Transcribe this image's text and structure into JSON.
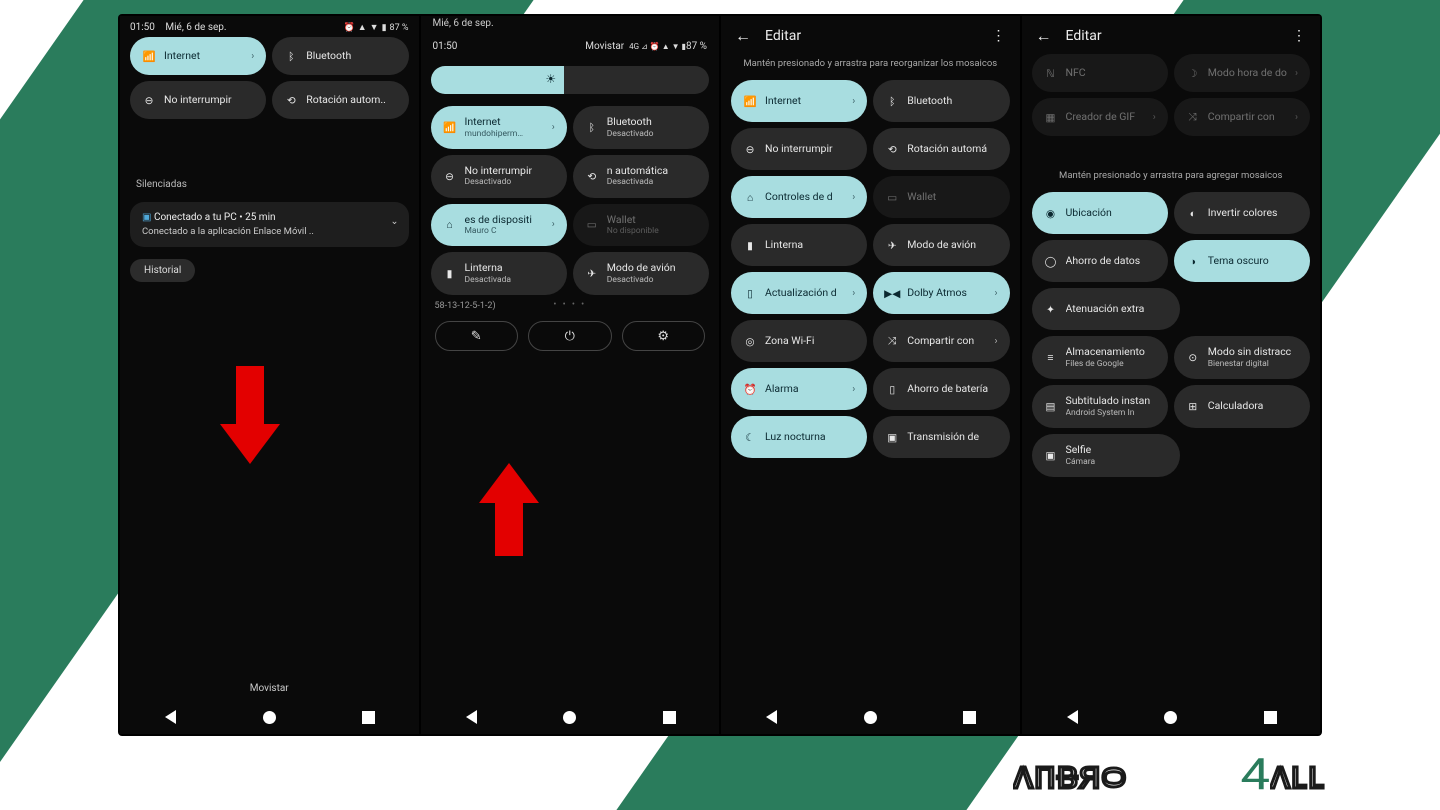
{
  "brand": {
    "name": "ANDRO",
    "accent": "4",
    "suffix": "ALL"
  },
  "colors": {
    "accent": "#a8dde0",
    "tileOff": "#2a2a2a",
    "bg": "#0a0a0a",
    "stripe": "#2a7c5c",
    "arrow": "#e30000"
  },
  "s1": {
    "status": {
      "time": "01:50",
      "date": "Mié, 6 de sep.",
      "carrier": "Movistar",
      "battery": "87 %"
    },
    "tiles": [
      {
        "label": "Internet",
        "on": true,
        "chev": true,
        "ico": "wifi"
      },
      {
        "label": "Bluetooth",
        "on": false,
        "ico": "bt"
      },
      {
        "label": "No interrumpir",
        "on": false,
        "ico": "dnd"
      },
      {
        "label": "Rotación autom..",
        "on": false,
        "ico": "rotate"
      }
    ],
    "silenced": "Silenciadas",
    "notif": {
      "title": "Conectado a tu PC • 25 min",
      "body": "Conectado a la aplicación Enlace Móvil .."
    },
    "chip": "Historial",
    "carrier_bottom": "Movistar"
  },
  "s2": {
    "date": "Mié, 6 de sep.",
    "status": {
      "time": "01:50",
      "carrier": "Movistar",
      "battery": "87 %"
    },
    "tiles": [
      {
        "label": "Internet",
        "sub": "mundohiperm…",
        "on": true,
        "chev": true,
        "ico": "wifi"
      },
      {
        "label": "Bluetooth",
        "sub": "Desactivado",
        "ico": "bt"
      },
      {
        "label": "No interrumpir",
        "sub": "Desactivado",
        "ico": "dnd"
      },
      {
        "label": "n automática",
        "sub": "Desactivada",
        "ico": "rotate"
      },
      {
        "label": "es de dispositi",
        "sub": "Mauro        C",
        "on": true,
        "chev": true,
        "ico": "home"
      },
      {
        "label": "Wallet",
        "sub": "No disponible",
        "dim": true,
        "ico": "wallet"
      },
      {
        "label": "Linterna",
        "sub": "Desactivada",
        "ico": "flash"
      },
      {
        "label": "Modo de avión",
        "sub": "Desactivado",
        "ico": "plane"
      }
    ],
    "footer": "58-13-12-5-1-2)",
    "controls": {
      "edit": "✎",
      "power": "⏻",
      "settings": "⚙"
    }
  },
  "s3": {
    "header": {
      "title": "Editar"
    },
    "hint": "Mantén presionado y arrastra para reorganizar los mosaicos",
    "tiles": [
      {
        "label": "Internet",
        "on": true,
        "chev": true,
        "ico": "wifi"
      },
      {
        "label": "Bluetooth",
        "ico": "bt"
      },
      {
        "label": "No interrumpir",
        "ico": "dnd"
      },
      {
        "label": "Rotación automá",
        "ico": "rotate"
      },
      {
        "label": "Controles de d",
        "on": true,
        "chev": true,
        "ico": "home"
      },
      {
        "label": "Wallet",
        "dim": true,
        "ico": "wallet"
      },
      {
        "label": "Linterna",
        "ico": "flash"
      },
      {
        "label": "Modo de avión",
        "ico": "plane"
      },
      {
        "label": "Actualización d",
        "on": true,
        "chev": true,
        "ico": "phone"
      },
      {
        "label": "Dolby Atmos",
        "on": true,
        "chev": true,
        "ico": "dolby"
      },
      {
        "label": "Zona Wi-Fi",
        "ico": "hotspot"
      },
      {
        "label": "Compartir con",
        "chev": true,
        "ico": "share"
      },
      {
        "label": "Alarma",
        "on": true,
        "chev": true,
        "ico": "alarm"
      },
      {
        "label": "Ahorro de batería",
        "ico": "battery"
      },
      {
        "label": "Luz nocturna",
        "on": true,
        "ico": "moon"
      },
      {
        "label": "Transmisión de",
        "ico": "cast"
      }
    ]
  },
  "s4": {
    "header": {
      "title": "Editar"
    },
    "top_tiles": [
      {
        "label": "NFC",
        "dim": true,
        "ico": "nfc"
      },
      {
        "label": "Modo hora de do",
        "dim": true,
        "chev": true,
        "ico": "bed"
      },
      {
        "label": "Creador de GIF",
        "dim": true,
        "chev": true,
        "ico": "gif"
      },
      {
        "label": "Compartir con",
        "dim": true,
        "chev": true,
        "ico": "share"
      }
    ],
    "hint": "Mantén presionado y arrastra para agregar mosaicos",
    "tiles": [
      {
        "label": "Ubicación",
        "on": true,
        "ico": "location"
      },
      {
        "label": "Invertir colores",
        "ico": "invert"
      },
      {
        "label": "Ahorro de datos",
        "ico": "data"
      },
      {
        "label": "Tema oscuro",
        "on": true,
        "ico": "dark"
      },
      {
        "label": "Atenuación extra",
        "ico": "dim"
      },
      {
        "label": "",
        "empty": true
      },
      {
        "label": "Almacenamiento",
        "sub": "Files de Google",
        "ico": "storage"
      },
      {
        "label": "Modo sin distracc",
        "sub": "Bienestar digital",
        "ico": "focus"
      },
      {
        "label": "Subtitulado instan",
        "sub": "Android System In",
        "ico": "caption"
      },
      {
        "label": "Calculadora",
        "ico": "calc"
      },
      {
        "label": "Selfie",
        "sub": "Cámara",
        "ico": "camera"
      },
      {
        "label": "",
        "empty": true
      }
    ]
  }
}
